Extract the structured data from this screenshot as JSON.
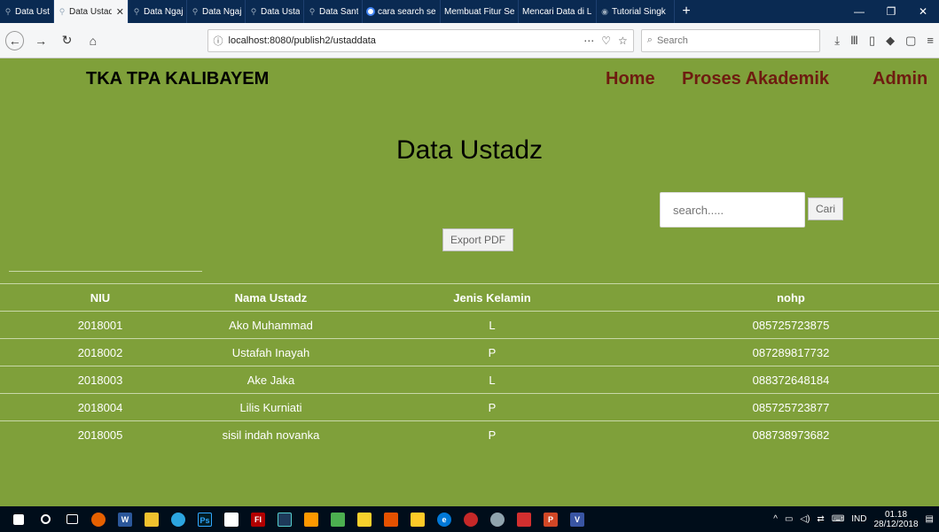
{
  "browser": {
    "tabs": [
      {
        "label": "Data Ustadz",
        "active": false
      },
      {
        "label": "Data Ustadz",
        "active": true
      },
      {
        "label": "Data Ngaji Santri",
        "active": false
      },
      {
        "label": "Data Ngaji Santri",
        "active": false
      },
      {
        "label": "Data Ustadz",
        "active": false
      },
      {
        "label": "Data Santri",
        "active": false
      },
      {
        "label": "cara search se",
        "active": false
      },
      {
        "label": "Membuat Fitur Se",
        "active": false
      },
      {
        "label": "Mencari Data di L",
        "active": false
      },
      {
        "label": "Tutorial Singk",
        "active": false
      }
    ],
    "url": "localhost:8080/publish2/ustaddata",
    "search_placeholder": "Search"
  },
  "nav": {
    "brand": "TKA TPA KALIBAYEM",
    "items": [
      {
        "label": "Home"
      },
      {
        "label": "Proses Akademik"
      },
      {
        "label": "Admin"
      }
    ]
  },
  "page": {
    "title": "Data Ustadz",
    "search_placeholder": "search.....",
    "search_button": "Cari",
    "export_button": "Export PDF"
  },
  "table": {
    "headers": [
      "NIU",
      "Nama Ustadz",
      "Jenis Kelamin",
      "nohp"
    ],
    "rows": [
      [
        "2018001",
        "Ako Muhammad",
        "L",
        "085725723875"
      ],
      [
        "2018002",
        "Ustafah Inayah",
        "P",
        "087289817732"
      ],
      [
        "2018003",
        "Ake Jaka",
        "L",
        "088372648184"
      ],
      [
        "2018004",
        "Lilis Kurniati",
        "P",
        "085725723877"
      ],
      [
        "2018005",
        "sisil indah novanka",
        "P",
        "088738973682"
      ]
    ]
  },
  "taskbar": {
    "lang": "IND",
    "time": "01.18",
    "date": "28/12/2018"
  },
  "colors": {
    "page_bg": "#7fa03a",
    "menu_text": "#6e1c10"
  }
}
